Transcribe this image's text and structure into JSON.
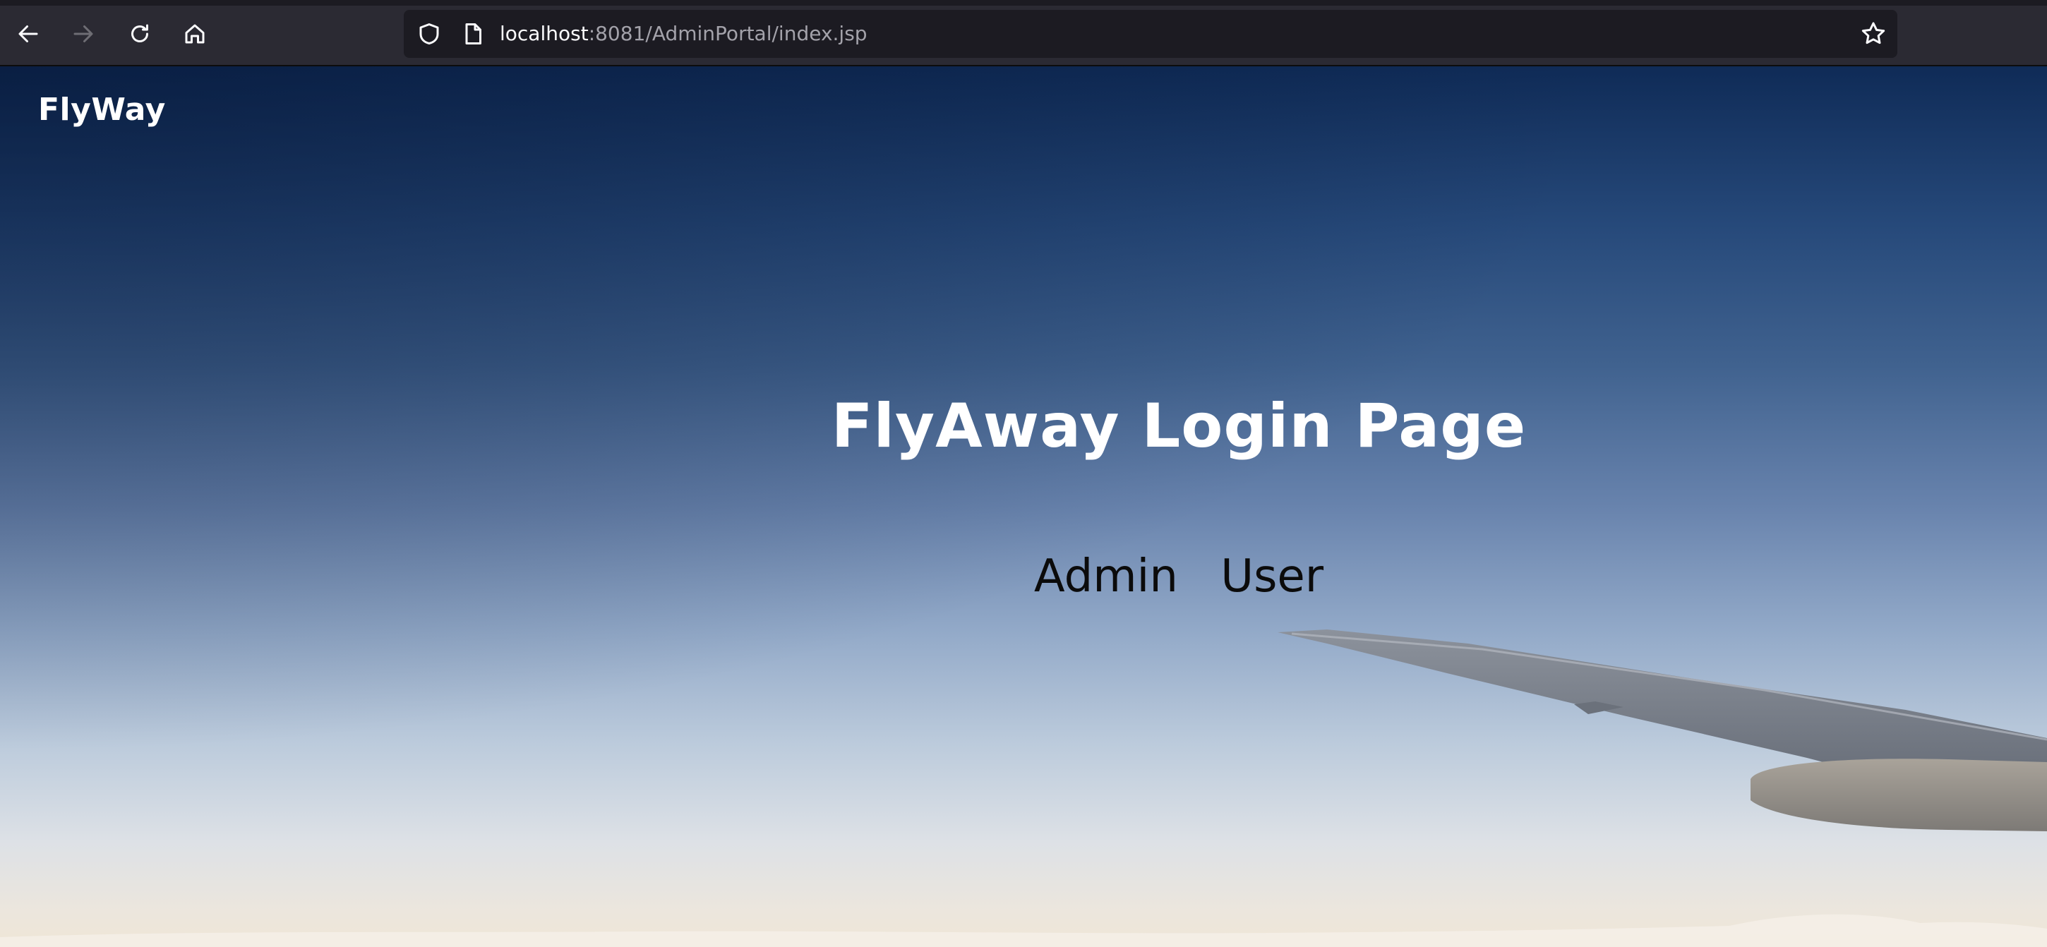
{
  "browser": {
    "url_host": "localhost",
    "url_rest": ":8081/AdminPortal/index.jsp",
    "icons": [
      "back-icon",
      "forward-icon",
      "reload-icon",
      "home-icon",
      "shield-icon",
      "page-icon",
      "bookmark-star-icon"
    ]
  },
  "page": {
    "brand": "FlyWay",
    "title": "FlyAway Login Page",
    "links": {
      "admin": "Admin",
      "user": "User"
    }
  },
  "colors": {
    "toolbar": "#2b2a33",
    "urlbar": "#1c1b22",
    "sky_top": "#0f2b57",
    "sky_bottom": "#efe6d6",
    "title_text": "#ffffff",
    "link_text": "#0b0b0b"
  }
}
